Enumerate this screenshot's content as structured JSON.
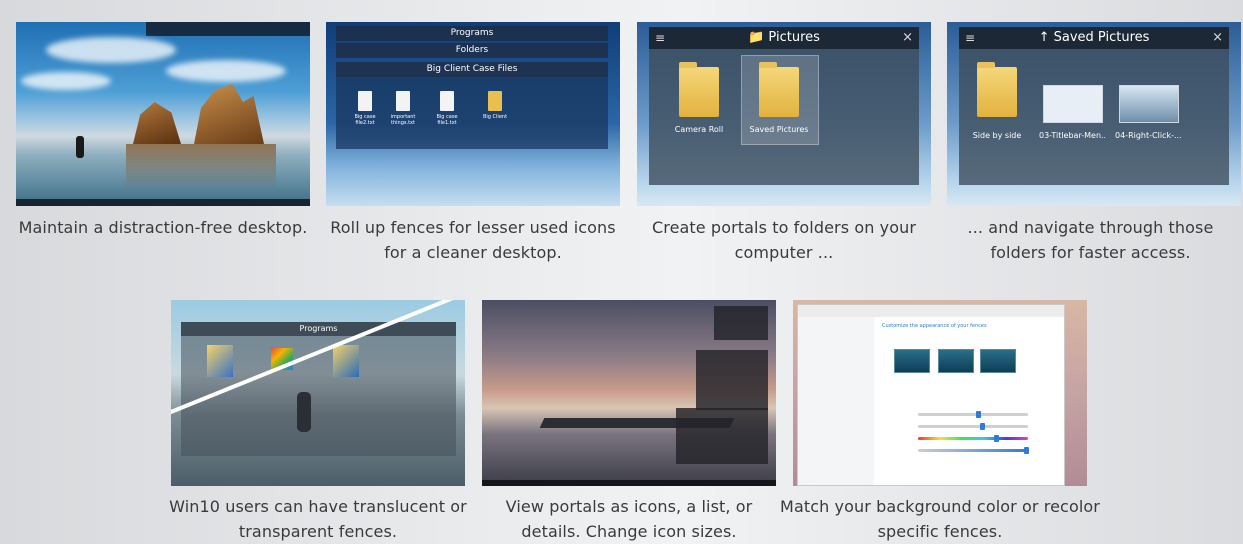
{
  "cards": [
    {
      "caption": "Maintain a distraction-free desktop.",
      "thumb_icon": "desktop-wallpaper-image"
    },
    {
      "caption": "Roll up fences for lesser used icons for a cleaner desktop.",
      "thumb": {
        "bars": [
          "Programs",
          "Folders",
          "Big Client Case Files"
        ],
        "files": [
          "Big case file2.txt",
          "important things.txt",
          "Big case file1.txt",
          "Big Client"
        ]
      }
    },
    {
      "caption": "Create portals to folders on your computer ...",
      "thumb": {
        "title": "Pictures",
        "items": [
          "Camera Roll",
          "Saved Pictures"
        ]
      }
    },
    {
      "caption": "... and navigate through those folders for faster access.",
      "thumb": {
        "title": "Saved Pictures",
        "items": [
          "Side by side",
          "03-Titlebar-Men...",
          "04-Right-Click-..."
        ]
      }
    },
    {
      "caption": "Win10 users can have translucent or transparent fences.",
      "thumb": {
        "title": "Programs"
      }
    },
    {
      "caption": "View portals as icons, a list, or details. Change icon sizes.",
      "thumb_icon": "portal-views-image"
    },
    {
      "caption": "Match your background color or recolor specific fences.",
      "thumb": {
        "heading": "Customize the appearance of your fences"
      }
    }
  ],
  "colors": {
    "caption_text": "#3a3a3a",
    "folder_yellow": "#e2b23e",
    "window_titlebar": "#19232f"
  }
}
